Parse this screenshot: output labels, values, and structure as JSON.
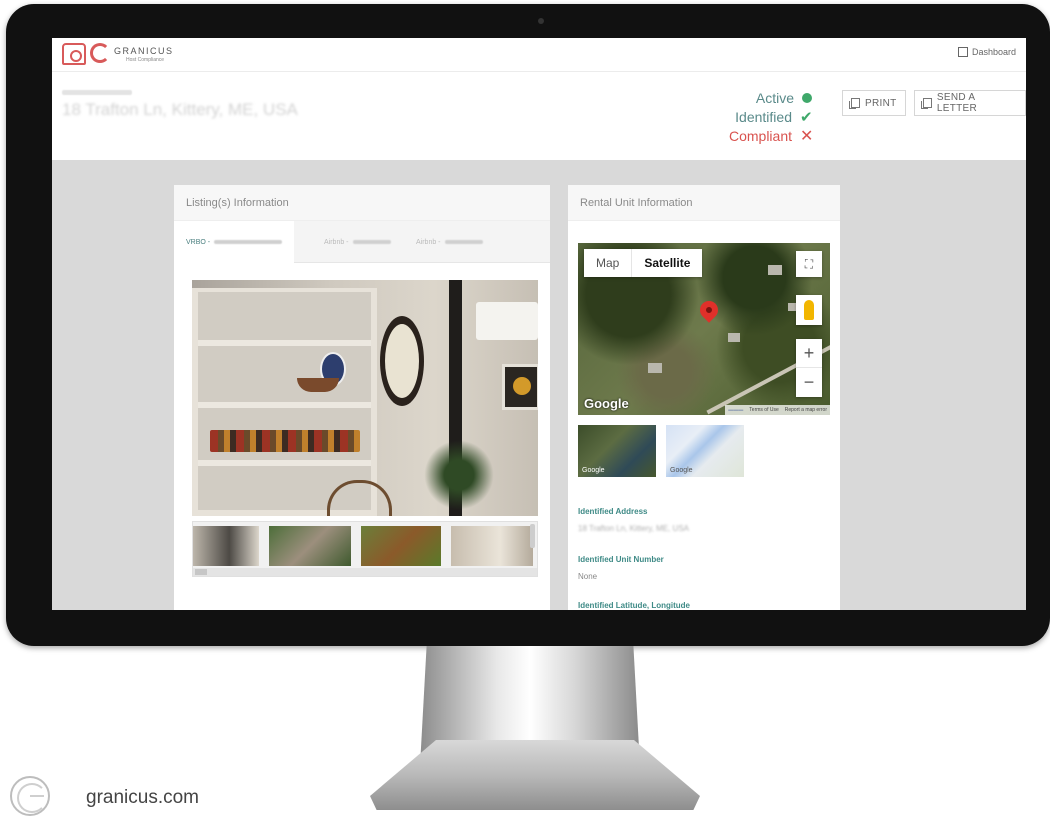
{
  "app": {
    "logo_word": "GRANICUS",
    "logo_sub": "Host Compliance",
    "dashboard_label": "Dashboard"
  },
  "property": {
    "label": "Rental Unit Name",
    "address": "18 Trafton Ln, Kittery, ME, USA"
  },
  "status": [
    {
      "label": "Active",
      "indicator": "green-dot",
      "color": "#3fa86a"
    },
    {
      "label": "Identified",
      "indicator": "check",
      "color": "#3fa86a"
    },
    {
      "label": "Compliant",
      "indicator": "cross",
      "color": "#d9534f"
    }
  ],
  "actions": {
    "print": "PRINT",
    "send_letter": "SEND A LETTER"
  },
  "listing": {
    "title": "Listing(s) Information",
    "tabs": [
      {
        "label": "VRBO -",
        "active": true
      },
      {
        "label": "Airbnb -",
        "active": false
      },
      {
        "label": "Airbnb -",
        "active": false
      }
    ]
  },
  "rental": {
    "title": "Rental Unit Information",
    "map": {
      "toggle_map": "Map",
      "toggle_satellite": "Satellite",
      "zoom_in": "+",
      "zoom_out": "−",
      "google": "Google",
      "footer_terms": "Terms of Use",
      "footer_report": "Report a map error",
      "mini_google_1": "Google",
      "mini_google_2": "Google"
    },
    "identified_address_label": "Identified Address",
    "identified_address_value": "18 Trafton Ln, Kittery, ME, USA",
    "unit_number_label": "Identified Unit Number",
    "unit_number_value": "None",
    "latlong_label": "Identified Latitude, Longitude"
  },
  "branding": {
    "site": "granicus.com"
  },
  "colors": {
    "accent_teal": "#3e8a86",
    "danger_red": "#d9534f",
    "success_green": "#3fa86a",
    "logo_red": "#d85a5a"
  }
}
